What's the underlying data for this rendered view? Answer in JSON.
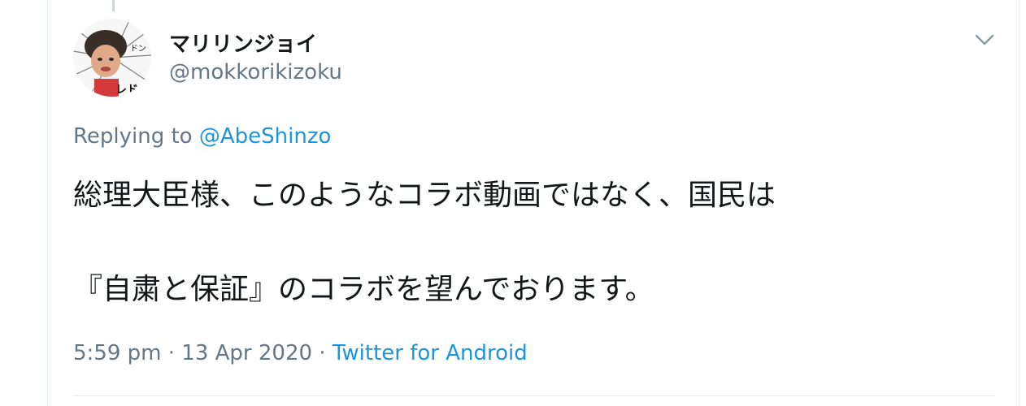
{
  "tweet": {
    "author": {
      "display_name": "マリリンジョイ",
      "handle": "@mokkorikizoku"
    },
    "menu_icon": "chevron-down-icon",
    "replying_prefix": "Replying to",
    "replying_to": "@AbeShinzo",
    "text_lines": [
      "総理大臣様、このようなコラボ動画ではなく、国民は",
      "『自粛と保証』のコラボを望んでおります。"
    ],
    "time": "5:59 pm",
    "date": "13 Apr 2020",
    "separator": "·",
    "source": "Twitter for Android"
  },
  "colors": {
    "link": "#1b95e0",
    "secondary_text": "#657786",
    "primary_text": "#14171a",
    "border": "#e6ecf0"
  }
}
